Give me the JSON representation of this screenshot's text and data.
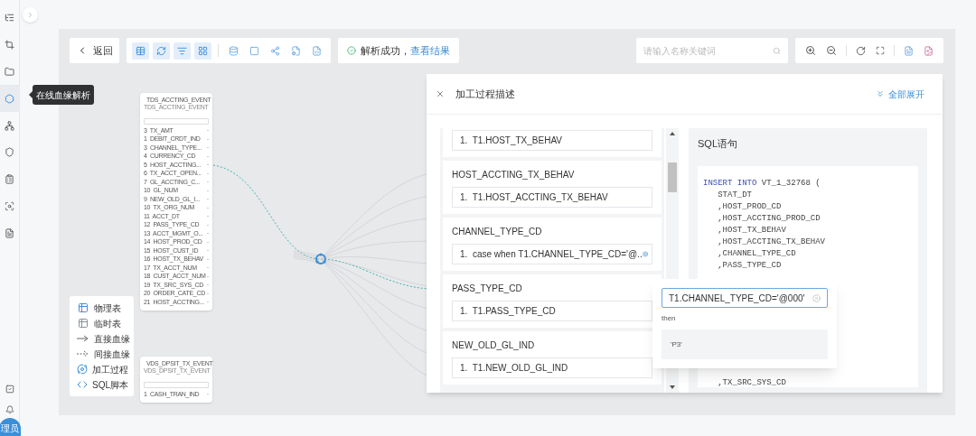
{
  "sidebar": {
    "items": [
      {
        "selected": false
      },
      {
        "selected": false
      },
      {
        "selected": false
      },
      {
        "selected": true
      },
      {
        "selected": false
      },
      {
        "selected": false
      },
      {
        "selected": false
      },
      {
        "selected": false
      },
      {
        "selected": false
      }
    ],
    "tooltip": "在线血缘解析",
    "avatar": "理员"
  },
  "toolbar": {
    "back": "返回",
    "tools": [
      {
        "selected": true
      },
      {
        "selected": true
      },
      {
        "selected": true
      },
      {
        "selected": true
      },
      {
        "selected": false
      },
      {
        "selected": false
      },
      {
        "selected": false
      },
      {
        "selected": false
      },
      {
        "selected": false
      }
    ],
    "status": {
      "text": "解析成功，",
      "link": "查看结果"
    },
    "search": {
      "placeholder": "请输入名称关键词"
    }
  },
  "canvas": {
    "nodes": [
      {
        "title": "TDS_ACCTING_EVENT",
        "subtitle": "TDS_ACCTING_EVENT",
        "fields": [
          "3  TX_AMT",
          "1  DEBIT_CRDT_IND",
          "3  CHANNEL_TYPE...",
          "4  CURRENCY_CD",
          "5  HOST_ACCTING...",
          "6  TX_ACCT_OPEN...",
          "7  GL_ACCTING_C...",
          "10  GL_NUM",
          "9  NEW_OLD_GL_I...",
          "10  TX_ORG_NUM",
          "11  ACCT_DT",
          "12  PASS_TYPE_CD",
          "13  ACCT_MGMT_O...",
          "14  HOST_PROD_CD",
          "15  HOST_CUST_ID",
          "16  HOST_TX_BEHAV",
          "17  TX_ACCT_NUM",
          "18  CUST_ACCT_NUM",
          "19  TX_SRC_SYS_CD",
          "20  ORDER_CATE_CD",
          "21  HOST_ACCTING..."
        ]
      },
      {
        "title": "VDS_DPSIT_TX_EVENT",
        "subtitle": "VDS_DPSIT_TX_EVENT",
        "fields": [
          "1  CASH_TRAN_IND"
        ]
      }
    ],
    "legend": [
      {
        "kind": "physical",
        "label": "物理表"
      },
      {
        "kind": "temp",
        "label": "临时表"
      },
      {
        "kind": "direct",
        "label": "直接血缘"
      },
      {
        "kind": "indirect",
        "label": "间接血缘"
      },
      {
        "kind": "process",
        "label": "加工过程"
      },
      {
        "kind": "sql",
        "label": "SQL脚本"
      }
    ]
  },
  "panel": {
    "title": "加工过程描述",
    "expand_all": "全部展开",
    "mappings": [
      {
        "value": "1.  T1.HOST_TX_BEHAV",
        "expandable": false
      },
      {
        "title": "HOST_ACCTING_TX_BEHAV",
        "value": "1.  T1.HOST_ACCTING_TX_BEHAV",
        "expandable": false
      },
      {
        "title": "CHANNEL_TYPE_CD",
        "value": "1.  case when T1.CHANNEL_TYPE_CD='@..",
        "expandable": true
      },
      {
        "title": "PASS_TYPE_CD",
        "value": "1.  T1.PASS_TYPE_CD",
        "expandable": false
      },
      {
        "title": "NEW_OLD_GL_IND",
        "value": "1.  T1.NEW_OLD_GL_IND",
        "expandable": false
      }
    ],
    "sql": {
      "title": "SQL语句",
      "keyword": "INSERT INTO",
      "code_top": [
        " VT_1_32768 (",
        "   STAT_DT",
        "   ,HOST_PROD_CD",
        "   ,HOST_ACCTING_PROD_CD",
        "   ,HOST_TX_BEHAV",
        "   ,HOST_ACCTING_TX_BEHAV",
        "   ,CHANNEL_TYPE_CD",
        "   ,PASS_TYPE_CD"
      ],
      "code_bottom": [
        "   ,TX_SRC_SYS_CD"
      ]
    },
    "popover": {
      "input": "T1.CHANNEL_TYPE_CD='@000'",
      "label": "then",
      "result": "'P3'"
    }
  }
}
